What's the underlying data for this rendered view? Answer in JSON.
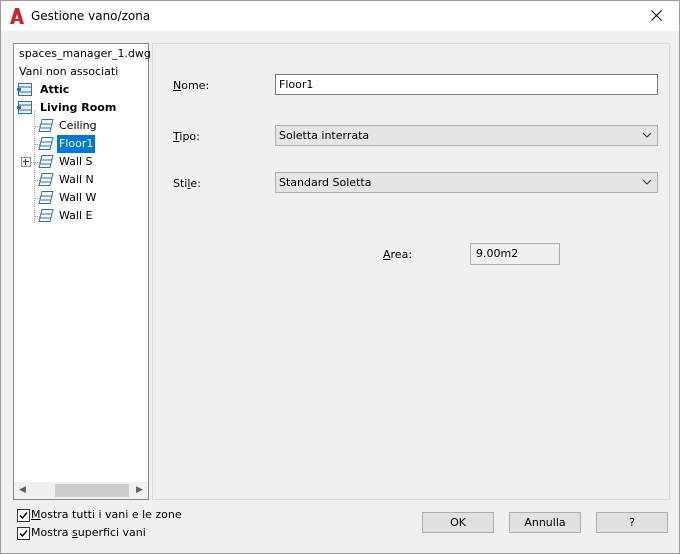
{
  "window": {
    "title": "Gestione vano/zona"
  },
  "tree": {
    "file": "spaces_manager_1.dwg",
    "unassigned": "Vani non associati",
    "items": [
      {
        "label": "Attic"
      },
      {
        "label": "Living Room"
      },
      {
        "label": "Ceiling"
      },
      {
        "label": "Floor1"
      },
      {
        "label": "Wall S"
      },
      {
        "label": "Wall N"
      },
      {
        "label": "Wall W"
      },
      {
        "label": "Wall E"
      }
    ]
  },
  "form": {
    "nome_label_u": "N",
    "nome_label_rest": "ome:",
    "nome_value": "Floor1",
    "tipo_label_u": "T",
    "tipo_label_rest": "ipo:",
    "tipo_value": "Soletta interrata",
    "stile_label_pre": "Sti",
    "stile_label_u": "l",
    "stile_label_rest": "e:",
    "stile_value": "Standard Soletta",
    "area_label_u": "A",
    "area_label_rest": "rea:",
    "area_value": "9.00m2"
  },
  "options": {
    "show_all_u": "M",
    "show_all_rest": "ostra tutti i vani e le zone",
    "show_surfaces_pre": "Mostra ",
    "show_surfaces_u": "s",
    "show_surfaces_rest": "uperfici vani"
  },
  "buttons": {
    "ok": "OK",
    "cancel": "Annulla",
    "help": "?"
  },
  "colors": {
    "selection": "#0078d7",
    "app_icon": "#d2232a"
  }
}
